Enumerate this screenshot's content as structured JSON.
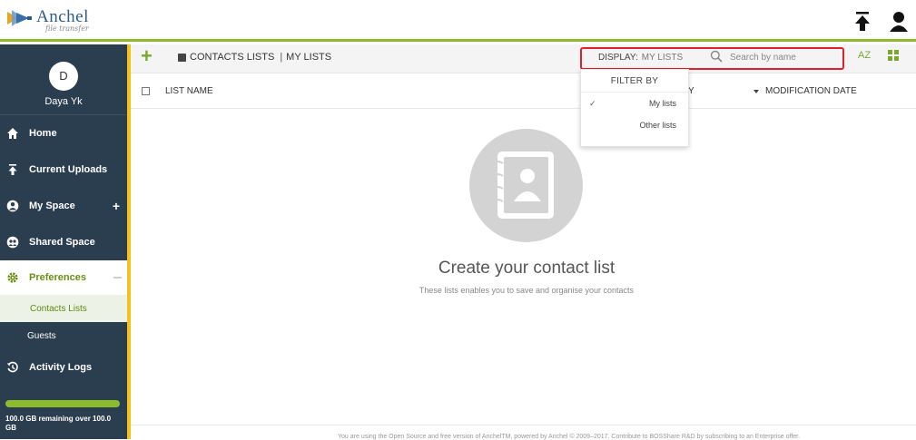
{
  "header": {
    "logo_name": "Anchel",
    "logo_subtitle": "file transfer",
    "upload_icon": "upload-icon",
    "user_icon": "user-icon"
  },
  "sidebar": {
    "avatar_initial": "D",
    "user_name": "Daya Yk",
    "items": [
      {
        "label": "Home",
        "icon": "home-icon"
      },
      {
        "label": "Current Uploads",
        "icon": "upload-icon"
      },
      {
        "label": "My Space",
        "icon": "person-circle-icon"
      },
      {
        "label": "Shared Space",
        "icon": "group-icon"
      },
      {
        "label": "Preferences",
        "icon": "gear-icon"
      },
      {
        "label": "Activity Logs",
        "icon": "history-icon"
      }
    ],
    "my_space_plus": "+",
    "subitems": {
      "contacts_lists": "Contacts Lists",
      "guests": "Guests"
    },
    "storage": {
      "used_fraction": 1.0,
      "text": "100.0 GB remaining over 100.0 GB"
    }
  },
  "toolbar": {
    "add_label": "+",
    "breadcrumb_root": "CONTACTS LISTS",
    "breadcrumb_separator": "|",
    "breadcrumb_current": "MY LISTS",
    "display_label": "DISPLAY:",
    "display_value": "MY LISTS",
    "search_placeholder": "Search by name",
    "sort_label": "AZ"
  },
  "table": {
    "col_name": "LIST NAME",
    "col_partial": "Y",
    "col_modification": "MODIFICATION DATE"
  },
  "dropdown": {
    "title": "FILTER BY",
    "options": [
      {
        "label": "My lists",
        "checked": true,
        "check_glyph": "✓"
      },
      {
        "label": "Other lists",
        "checked": false
      }
    ]
  },
  "empty_state": {
    "icon": "contact-book-icon",
    "title": "Create your contact list",
    "subtitle": "These lists enables you to save and organise your contacts"
  },
  "footer": {
    "text": "You are using the Open Source and free version of AnchelTM, powered by Anchel © 2009–2017. Contribute to BOSShare R&D by subscribing to an Enterprise offer."
  },
  "colors": {
    "accent_green": "#8dbb2e",
    "sidebar_bg": "#2b3e50",
    "sidebar_accent": "#f3c21b",
    "highlight_red": "#e0202c"
  }
}
